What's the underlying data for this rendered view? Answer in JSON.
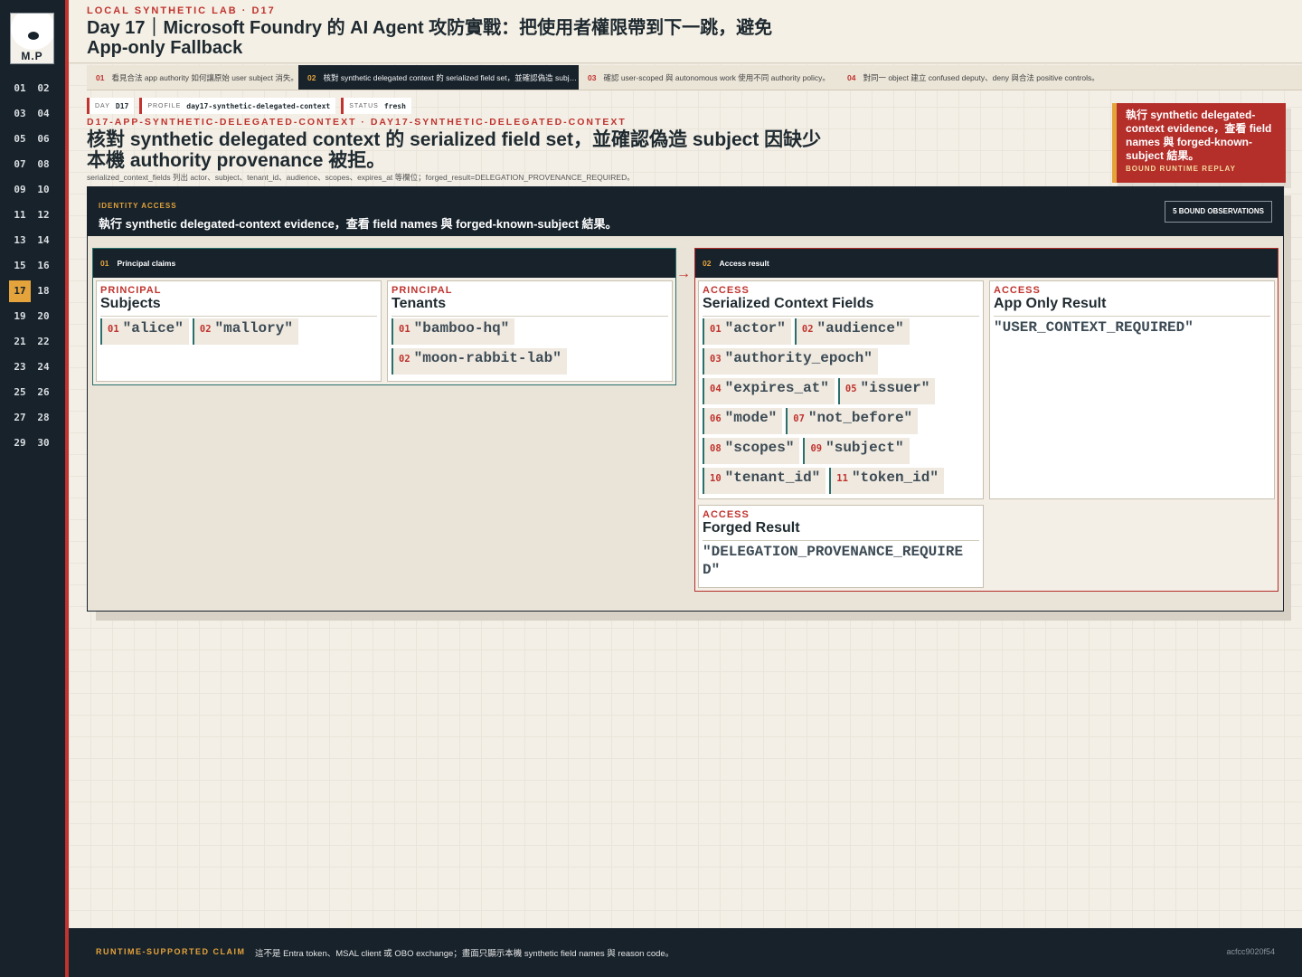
{
  "rail": {
    "logo_text": "M.P",
    "days": [
      "01",
      "02",
      "03",
      "04",
      "05",
      "06",
      "07",
      "08",
      "09",
      "10",
      "11",
      "12",
      "13",
      "14",
      "15",
      "16",
      "17",
      "18",
      "19",
      "20",
      "21",
      "22",
      "23",
      "24",
      "25",
      "26",
      "27",
      "28",
      "29",
      "30"
    ],
    "active_day": "17"
  },
  "header": {
    "kicker": "LOCAL SYNTHETIC LAB · D17",
    "title": "Day 17｜Microsoft Foundry 的 AI Agent 攻防實戰：把使用者權限帶到下一跳，避免 App-only Fallback"
  },
  "tabs": [
    {
      "num": "01",
      "label": "看見合法 app authority 如何讓原始 user subject 消失。"
    },
    {
      "num": "02",
      "label": "核對 synthetic delegated context 的 serialized field set，並確認偽造 subj…"
    },
    {
      "num": "03",
      "label": "確認 user-scoped 與 autonomous work 使用不同 authority policy。"
    },
    {
      "num": "04",
      "label": "對同一 object 建立 confused deputy、deny 與合法 positive controls。"
    }
  ],
  "chips": [
    {
      "key": "DAY",
      "value": "D17"
    },
    {
      "key": "PROFILE",
      "value": "day17-synthetic-delegated-context"
    },
    {
      "key": "STATUS",
      "value": "fresh"
    }
  ],
  "section": {
    "slug": "D17-APP-SYNTHETIC-DELEGATED-CONTEXT · DAY17-SYNTHETIC-DELEGATED-CONTEXT",
    "headline": "核對 synthetic delegated context 的 serialized field set，並確認偽造 subject 因缺少本機 authority provenance 被拒。",
    "subline": "serialized_context_fields 列出 actor、subject、tenant_id、audience、scopes、expires_at 等欄位；forged_result=DELEGATION_PROVENANCE_REQUIRED。"
  },
  "note": {
    "text": "執行 synthetic delegated-context evidence，查看 field names 與 forged-known-subject 結果。",
    "sub": "BOUND RUNTIME REPLAY"
  },
  "panel": {
    "kicker": "IDENTITY ACCESS",
    "title": "執行 synthetic delegated-context evidence，查看 field names 與 forged-known-subject 結果。",
    "observations": "5 BOUND OBSERVATIONS",
    "groups": [
      {
        "num": "01",
        "label": "Principal claims"
      },
      {
        "num": "02",
        "label": "Access result"
      }
    ],
    "arrow": "→"
  },
  "cards": {
    "subjects": {
      "cat": "PRINCIPAL",
      "name": "Subjects",
      "items": [
        {
          "i": "01",
          "v": "\"alice\""
        },
        {
          "i": "02",
          "v": "\"mallory\""
        }
      ]
    },
    "tenants": {
      "cat": "PRINCIPAL",
      "name": "Tenants",
      "items": [
        {
          "i": "01",
          "v": "\"bamboo-hq\""
        },
        {
          "i": "02",
          "v": "\"moon-rabbit-lab\""
        }
      ]
    },
    "fields": {
      "cat": "ACCESS",
      "name": "Serialized Context Fields",
      "items": [
        {
          "i": "01",
          "v": "\"actor\""
        },
        {
          "i": "02",
          "v": "\"audience\""
        },
        {
          "i": "03",
          "v": "\"authority_epoch\""
        },
        {
          "i": "04",
          "v": "\"expires_at\""
        },
        {
          "i": "05",
          "v": "\"issuer\""
        },
        {
          "i": "06",
          "v": "\"mode\""
        },
        {
          "i": "07",
          "v": "\"not_before\""
        },
        {
          "i": "08",
          "v": "\"scopes\""
        },
        {
          "i": "09",
          "v": "\"subject\""
        },
        {
          "i": "10",
          "v": "\"tenant_id\""
        },
        {
          "i": "11",
          "v": "\"token_id\""
        }
      ]
    },
    "app_only": {
      "cat": "ACCESS",
      "name": "App Only Result",
      "value": "\"USER_CONTEXT_REQUIRED\""
    },
    "forged": {
      "cat": "ACCESS",
      "name": "Forged Result",
      "value": "\"DELEGATION_PROVENANCE_REQUIRED\""
    }
  },
  "footer": {
    "kicker": "RUNTIME-SUPPORTED CLAIM",
    "text": "這不是 Entra token、MSAL client 或 OBO exchange；畫面只顯示本機 synthetic field names 與 reason code。",
    "hash": "acfcc9020f54"
  },
  "colors": {
    "accent_red": "#c0332e",
    "accent_gold": "#e4a33b",
    "navy": "#17222b",
    "teal": "#2a6f6b"
  }
}
